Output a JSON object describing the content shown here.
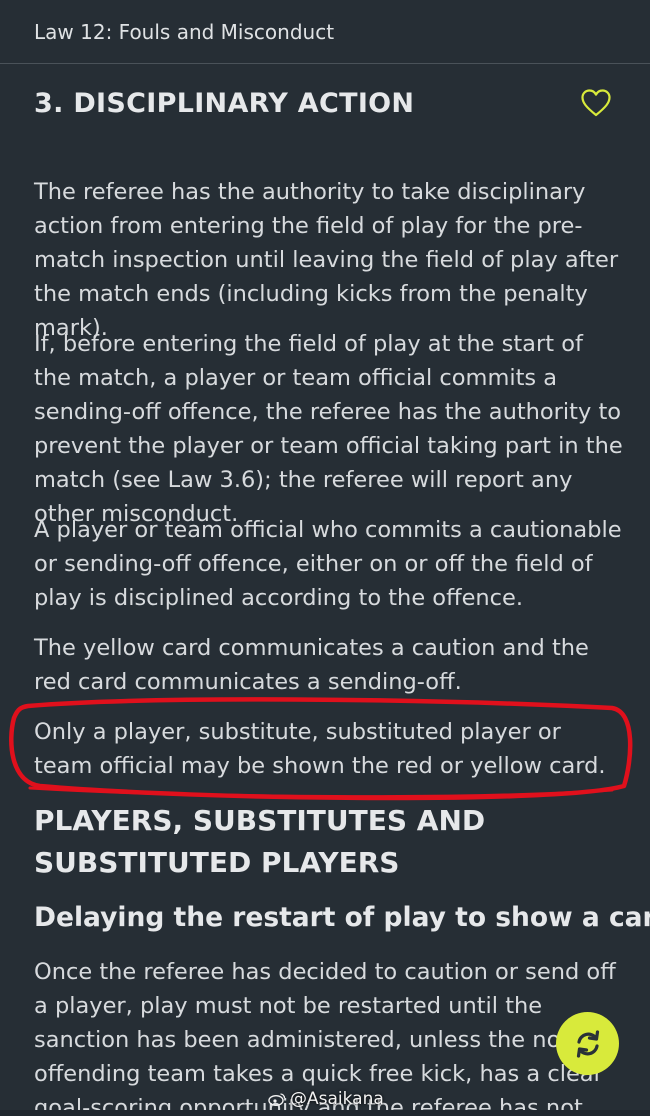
{
  "header": {
    "title": "Law 12: Fouls and Misconduct"
  },
  "section": {
    "title": "3. DISCIPLINARY ACTION",
    "favorite_icon": "heart-outline-icon"
  },
  "paragraphs": [
    "The referee has the authority to take disciplinary action from entering the field of play for the pre-match inspection until leaving the field of play after the match ends (including kicks from the penalty mark).",
    "If, before entering the field of play at the start of the match, a player or team official commits a sending-off offence, the referee has the authority to prevent the player or team official taking part in the match (see Law 3.6); the referee will report any other misconduct.",
    "A player or team official who commits a cautionable or sending-off offence, either on or off the field of play is disciplined according to the offence.",
    "The yellow card communicates a caution and the red card communicates a sending-off.",
    "Only a player, substitute, substituted player or team official may be shown the red or yellow card."
  ],
  "subheading": "PLAYERS, SUBSTITUTES AND SUBSTITUTED PLAYERS",
  "subsubheading": "Delaying the restart of play to show a card",
  "final_paragraph": "Once the referee has decided to caution or send off a player, play must not be restarted until the sanction has been administered, unless the non-offending team takes a quick free kick, has a clear goal-scoring opportunity and the referee has not started the",
  "fab": {
    "icon": "refresh-icon",
    "color": "#d8ea3b"
  },
  "watermark": {
    "text": "@Asaikana"
  },
  "colors": {
    "background": "#262e35",
    "accent": "#d8ea3b",
    "annotation": "#e0101c"
  }
}
